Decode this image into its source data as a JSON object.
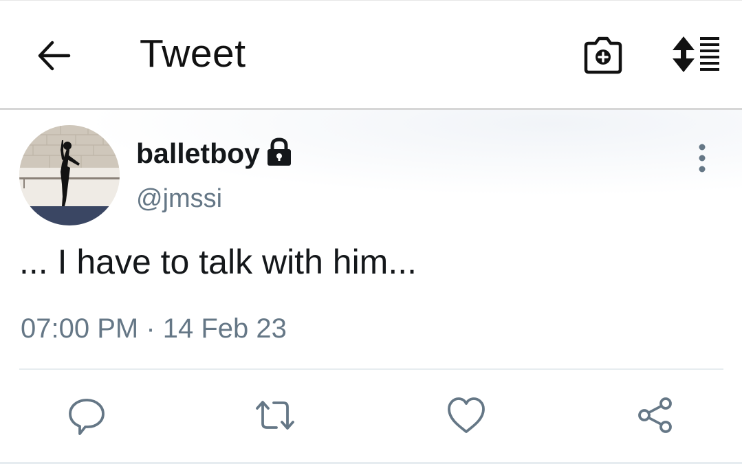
{
  "header": {
    "title": "Tweet",
    "back_icon": "arrow-left-icon",
    "camera_icon": "camera-add-icon",
    "sort_icon": "sort-list-icon"
  },
  "tweet": {
    "display_name": "balletboy",
    "handle": "@jmssi",
    "protected_icon": "lock-icon",
    "more_icon": "more-vertical-icon",
    "text": "... I have to talk with him...",
    "timestamp": "07:00 PM · 14 Feb 23"
  },
  "actions": [
    {
      "name": "reply",
      "icon": "reply-icon"
    },
    {
      "name": "retweet",
      "icon": "retweet-icon"
    },
    {
      "name": "like",
      "icon": "heart-icon"
    },
    {
      "name": "share",
      "icon": "share-icon"
    }
  ],
  "colors": {
    "text_primary": "#14171a",
    "text_secondary": "#657786",
    "icon_secondary": "#657786",
    "divider": "#e6ecf0"
  }
}
